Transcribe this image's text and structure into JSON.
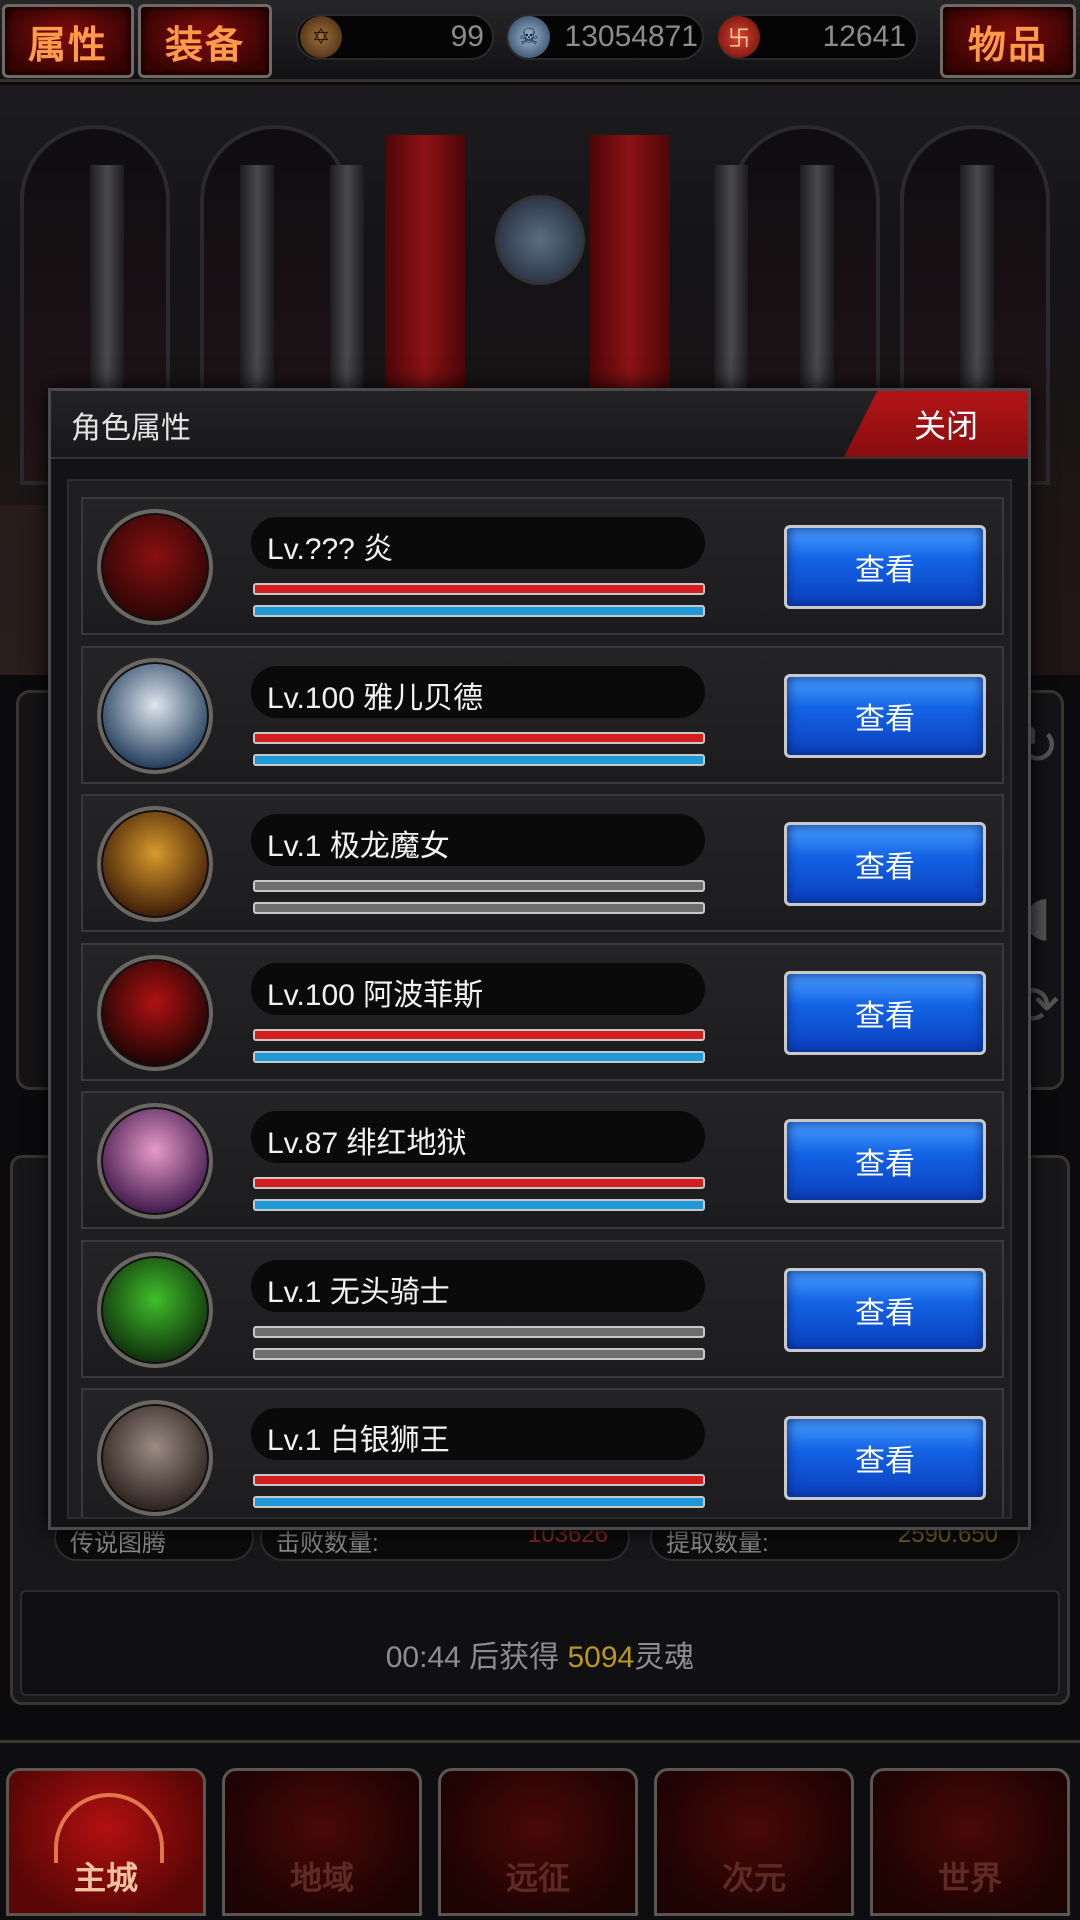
{
  "top_bar": {
    "attributes_label": "属性",
    "equipment_label": "装备",
    "items_label": "物品",
    "resources": [
      {
        "icon": "pentagram-icon",
        "value": "99"
      },
      {
        "icon": "skull-icon",
        "value": "13054871"
      },
      {
        "icon": "flame-emblem-icon",
        "value": "12641"
      }
    ]
  },
  "modal": {
    "title": "角色属性",
    "close_label": "关闭",
    "rows": [
      {
        "name": "Lv.??? 炎",
        "hp": 1.0,
        "mp": 1.0,
        "active": true,
        "button": "查看",
        "colors": [
          "#8a1010",
          "#2a0505"
        ]
      },
      {
        "name": "Lv.100 雅儿贝德",
        "hp": 1.0,
        "mp": 1.0,
        "active": true,
        "button": "查看",
        "colors": [
          "#dfe6ee",
          "#1a3656"
        ]
      },
      {
        "name": "Lv.1 极龙魔女",
        "hp": 0.0,
        "mp": 0.0,
        "active": false,
        "button": "查看",
        "colors": [
          "#d79a2a",
          "#3a1808"
        ]
      },
      {
        "name": "Lv.100 阿波菲斯",
        "hp": 1.0,
        "mp": 1.0,
        "active": true,
        "button": "查看",
        "colors": [
          "#b01212",
          "#180404"
        ]
      },
      {
        "name": "Lv.87 绯红地狱",
        "hp": 1.0,
        "mp": 1.0,
        "active": true,
        "button": "查看",
        "colors": [
          "#e79ac9",
          "#3b1548"
        ]
      },
      {
        "name": "Lv.1 无头骑士",
        "hp": 0.0,
        "mp": 0.0,
        "active": false,
        "button": "查看",
        "colors": [
          "#3fbf2a",
          "#0f2a0c"
        ]
      },
      {
        "name": "Lv.1 白银狮王",
        "hp": 1.0,
        "mp": 1.0,
        "active": true,
        "button": "查看",
        "colors": [
          "#9a8c82",
          "#2a1e1c"
        ]
      }
    ]
  },
  "background_panel": {
    "stats": [
      {
        "label": "传说图腾",
        "value": ""
      },
      {
        "label": "击败数量:",
        "value": "103626"
      },
      {
        "label": "提取数量:",
        "value": "2590.650"
      }
    ],
    "timer": {
      "time": "00:44",
      "middle": " 后获得 ",
      "amount": "5094",
      "unit": "灵魂"
    }
  },
  "bottom_nav": {
    "items": [
      {
        "label": "主城",
        "active": true
      },
      {
        "label": "地域",
        "active": false
      },
      {
        "label": "远征",
        "active": false
      },
      {
        "label": "次元",
        "active": false
      },
      {
        "label": "世界",
        "active": false
      }
    ]
  },
  "colors": {
    "hp": "#d41e1e",
    "mp": "#1e9ad8",
    "accent_red": "#b31417",
    "button_blue": "#1463e6",
    "gold": "#b9981f"
  }
}
